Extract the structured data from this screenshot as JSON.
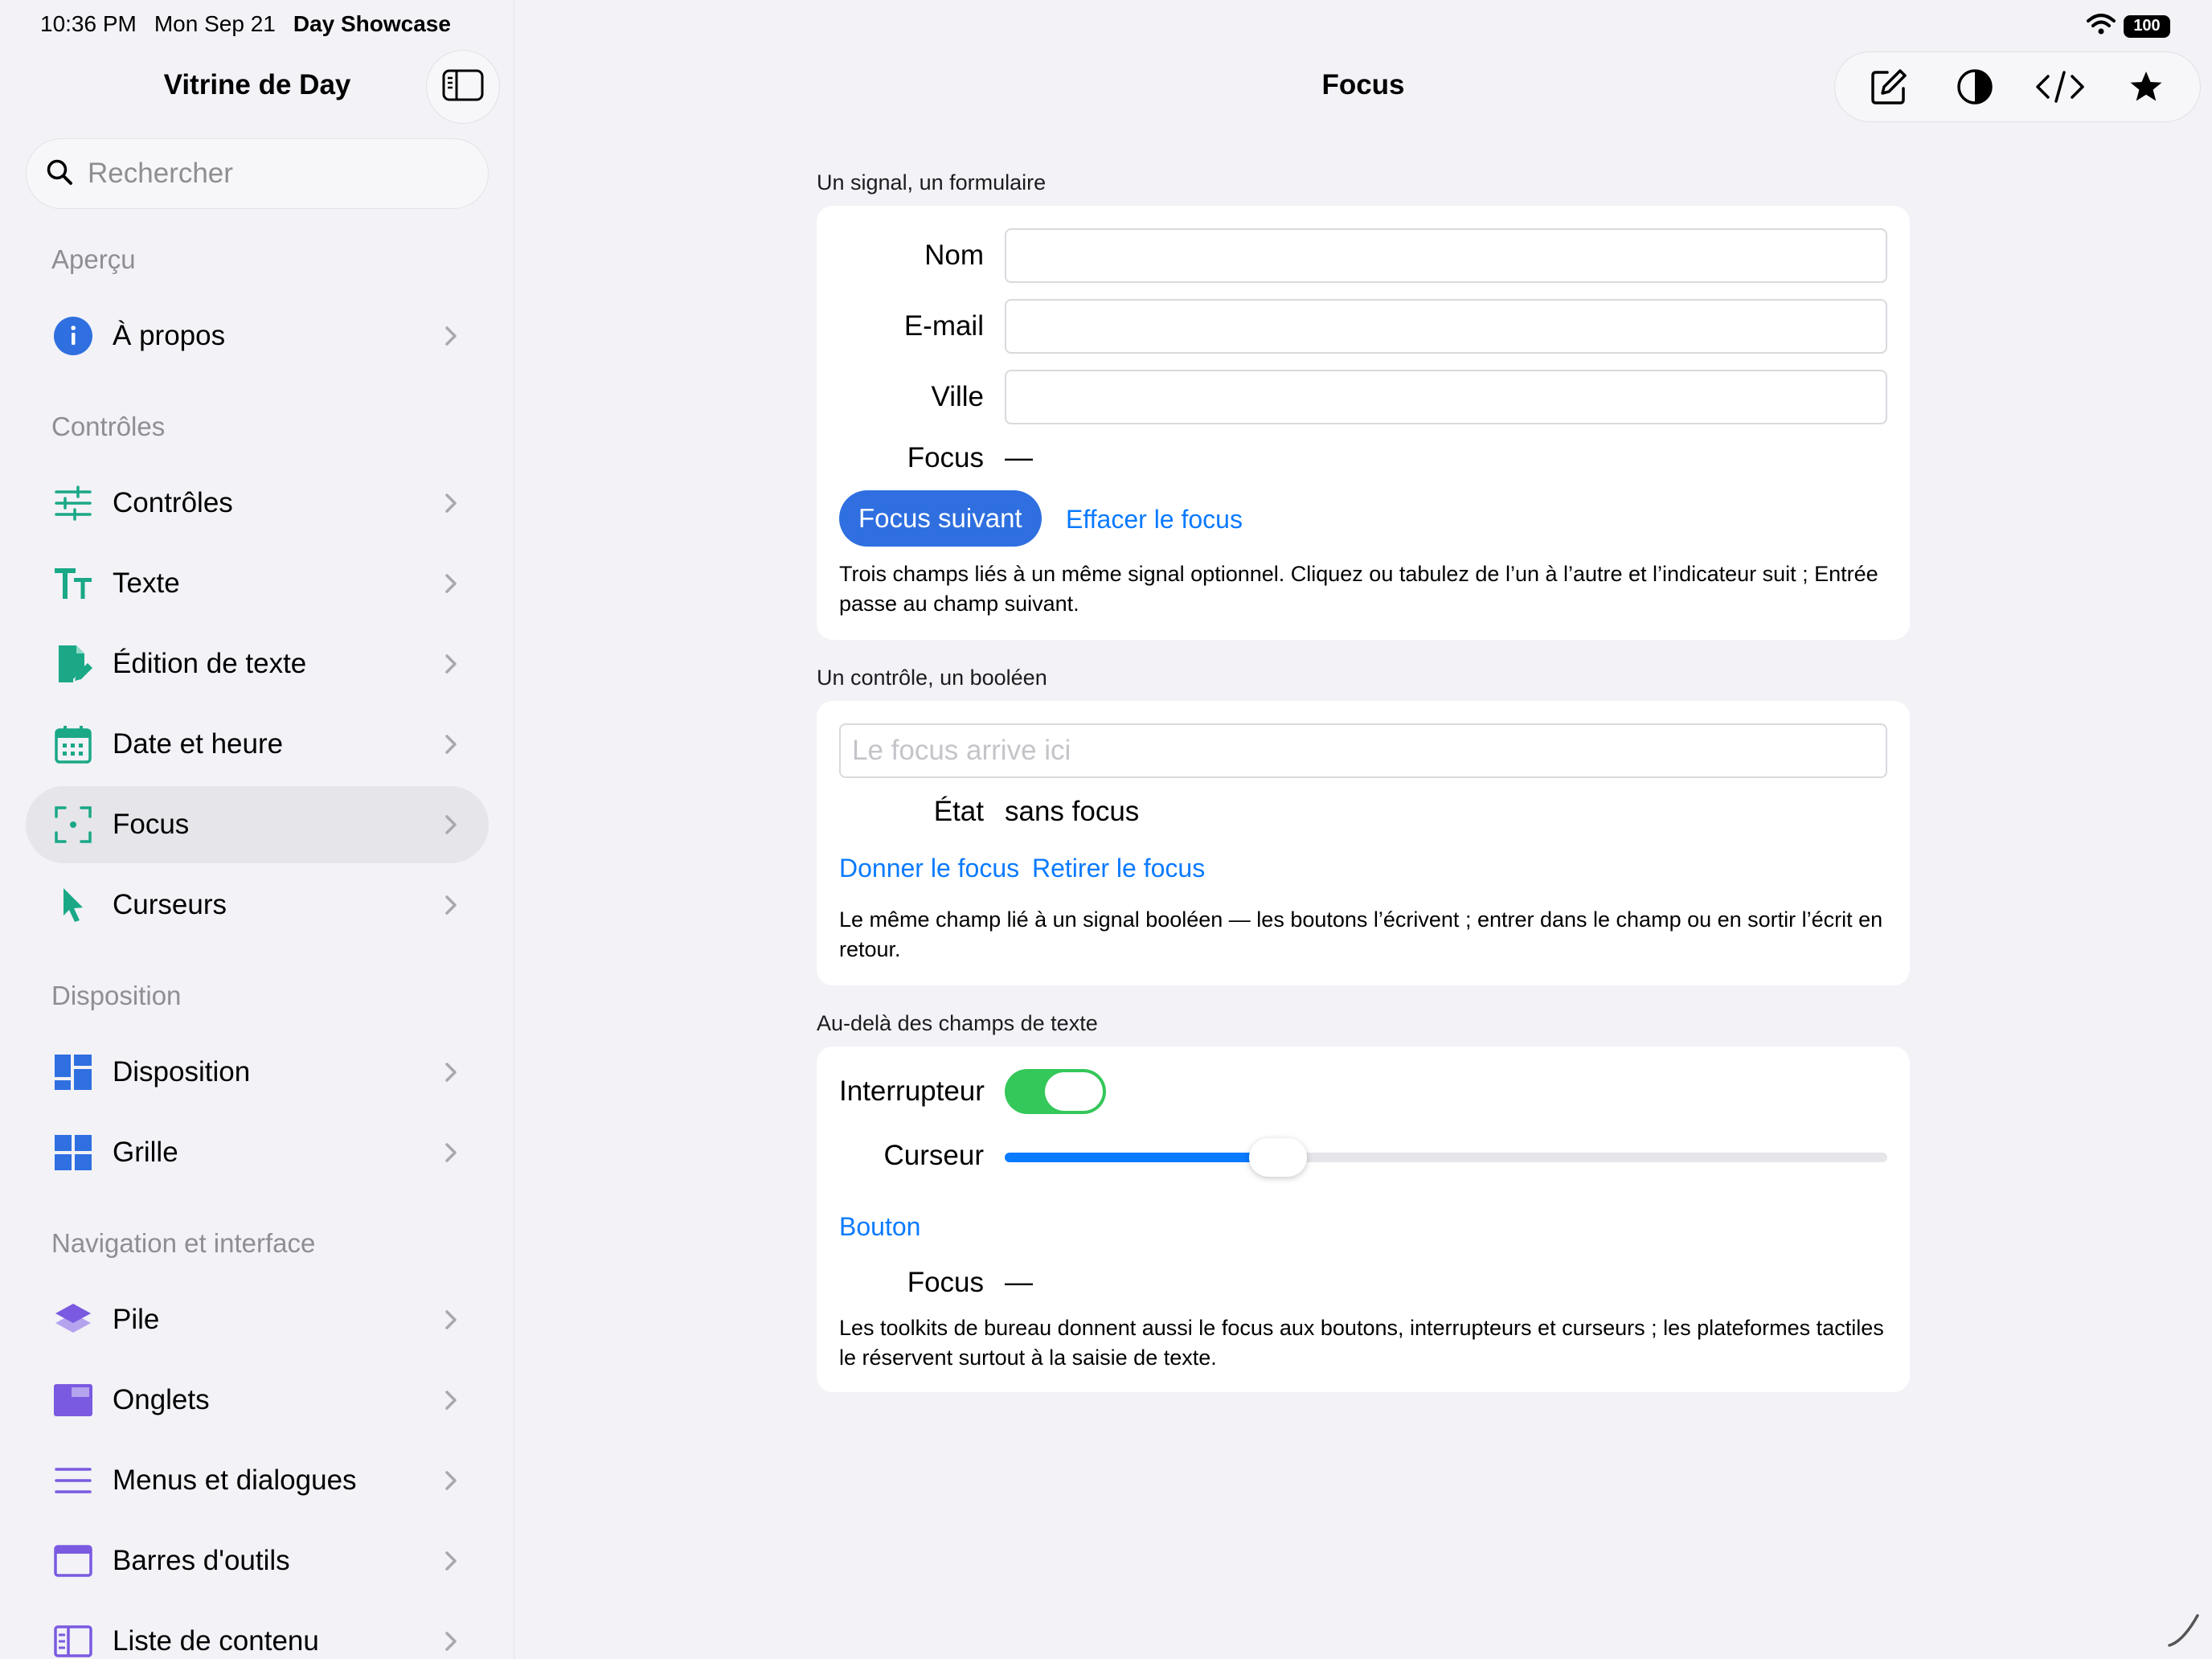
{
  "status_bar": {
    "time": "10:36 PM",
    "date": "Mon Sep 21",
    "app": "Day Showcase",
    "battery": "100"
  },
  "sidebar": {
    "title": "Vitrine de Day",
    "search_placeholder": "Rechercher",
    "sections": [
      {
        "header": "Aperçu",
        "items": [
          {
            "label": "À propos",
            "icon": "info-icon",
            "color": "#2f6fe0"
          }
        ]
      },
      {
        "header": "Contrôles",
        "items": [
          {
            "label": "Contrôles",
            "icon": "sliders-icon",
            "color": "#1aa886"
          },
          {
            "label": "Texte",
            "icon": "text-size-icon",
            "color": "#1aa886"
          },
          {
            "label": "Édition de texte",
            "icon": "document-edit-icon",
            "color": "#1aa886"
          },
          {
            "label": "Date et heure",
            "icon": "calendar-icon",
            "color": "#1aa886"
          },
          {
            "label": "Focus",
            "icon": "focus-viewfinder-icon",
            "color": "#1aa886",
            "selected": true
          },
          {
            "label": "Curseurs",
            "icon": "cursor-arrow-icon",
            "color": "#1aa886"
          }
        ]
      },
      {
        "header": "Disposition",
        "items": [
          {
            "label": "Disposition",
            "icon": "layout-icon",
            "color": "#2f6fe0"
          },
          {
            "label": "Grille",
            "icon": "grid-icon",
            "color": "#2f6fe0"
          }
        ]
      },
      {
        "header": "Navigation et interface",
        "items": [
          {
            "label": "Pile",
            "icon": "stack-icon",
            "color": "#7a5ae0"
          },
          {
            "label": "Onglets",
            "icon": "tabs-icon",
            "color": "#7a5ae0"
          },
          {
            "label": "Menus et dialogues",
            "icon": "menu-lines-icon",
            "color": "#7a5ae0"
          },
          {
            "label": "Barres d'outils",
            "icon": "toolbar-window-icon",
            "color": "#7a5ae0"
          },
          {
            "label": "Liste de contenu",
            "icon": "list-detail-icon",
            "color": "#7a5ae0"
          }
        ]
      }
    ]
  },
  "main": {
    "title": "Focus",
    "toolbar": [
      "compose-icon",
      "contrast-icon",
      "code-icon",
      "star-icon"
    ],
    "groups": {
      "form": {
        "header": "Un signal, un formulaire",
        "name_label": "Nom",
        "email_label": "E-mail",
        "city_label": "Ville",
        "focus_label": "Focus",
        "focus_value": "—",
        "next_button": "Focus suivant",
        "clear_link": "Effacer le focus",
        "note": "Trois champs liés à un même signal optionnel. Cliquez ou tabulez de l’un à l’autre et l’indicateur suit ; Entrée passe au champ suivant."
      },
      "boolean": {
        "header": "Un contrôle, un booléen",
        "placeholder": "Le focus arrive ici",
        "state_label": "État",
        "state_value": "sans focus",
        "give_link": "Donner le focus",
        "remove_link": "Retirer le focus",
        "note": "Le même champ lié à un signal booléen — les boutons l’écrivent ; entrer dans le champ ou en sortir l’écrit en retour."
      },
      "beyond": {
        "header": "Au-delà des champs de texte",
        "switch_label": "Interrupteur",
        "switch_on": true,
        "slider_label": "Curseur",
        "slider_value": 0.31,
        "button_link": "Bouton",
        "focus_label": "Focus",
        "focus_value": "—",
        "note": "Les toolkits de bureau donnent aussi le focus aux boutons, interrupteurs et curseurs ; les plateformes tactiles le réservent surtout à la saisie de texte."
      }
    }
  },
  "colors": {
    "accent": "#0a7aff",
    "primary_button": "#2f6fe0",
    "switch_on": "#34c759",
    "selection": "#e5e5ea"
  }
}
